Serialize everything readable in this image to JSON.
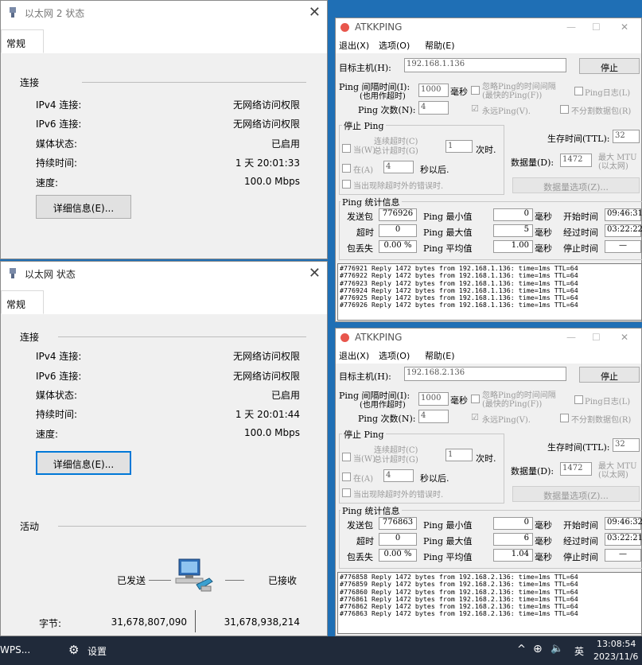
{
  "win1": {
    "title": "以太网 2 状态",
    "tab": "常规",
    "section_connection": "连接",
    "rows": [
      {
        "label": "IPv4 连接:",
        "value": "无网络访问权限"
      },
      {
        "label": "IPv6 连接:",
        "value": "无网络访问权限"
      },
      {
        "label": "媒体状态:",
        "value": "已启用"
      },
      {
        "label": "持续时间:",
        "value": "1 天 20:01:33"
      },
      {
        "label": "速度:",
        "value": "100.0 Mbps"
      }
    ],
    "details_button": "详细信息(E)..."
  },
  "win2": {
    "title": "以太网 状态",
    "tab": "常规",
    "section_connection": "连接",
    "rows": [
      {
        "label": "IPv4 连接:",
        "value": "无网络访问权限"
      },
      {
        "label": "IPv6 连接:",
        "value": "无网络访问权限"
      },
      {
        "label": "媒体状态:",
        "value": "已启用"
      },
      {
        "label": "持续时间:",
        "value": "1 天 20:01:44"
      },
      {
        "label": "速度:",
        "value": "100.0 Mbps"
      }
    ],
    "details_button": "详细信息(E)...",
    "section_activity": "活动",
    "sent_label": "已发送",
    "received_label": "已接收",
    "bytes_label": "字节:",
    "bytes_sent": "31,678,807,090",
    "bytes_received": "31,678,938,214"
  },
  "atk_common": {
    "title": "ATKKPING",
    "menu": [
      "退出(X)",
      "选项(O)",
      "帮助(E)"
    ],
    "target_label": "目标主机(H):",
    "stop_button": "停止",
    "ping_interval_label": "Ping 间隔时间(I):",
    "ping_interval_sub": "(也用作超时)",
    "ms_label": "毫秒",
    "ignore_interval_1": "忽略Ping的时间间隔",
    "ignore_interval_2": "(最快的Ping(F))",
    "ping_log_label": "Ping日志(L)",
    "ping_count_label": "Ping 次数(N):",
    "ping_count_value": "4",
    "forever_label": "永远Ping(V).",
    "no_fragment_label": "不分割数据包(R)",
    "stop_ping_group": "停止 Ping",
    "when_label": "当(W)",
    "consec_timeout": "连续超时(C)",
    "total_timeout": "总计超时(G)",
    "timeout_value": "1",
    "times_label": "次时.",
    "at_label": "在(A)",
    "at_value": "4",
    "seconds_after": "秒以后.",
    "error_stop": "当出现除超时外的错误时.",
    "ttl_label": "生存时间(TTL):",
    "ttl_value": "32",
    "data_size_label": "数据量(D):",
    "data_size_value": "1472",
    "max_mtu_1": "最大 MTU",
    "max_mtu_2": "(以太网)",
    "data_options": "数据量选项(Z)...",
    "stats_group": "Ping 统计信息",
    "sent_label": "发送包",
    "timeout_label": "超时",
    "loss_label": "包丢失",
    "min_label": "Ping 最小值",
    "max_label": "Ping 最大值",
    "avg_label": "Ping 平均值",
    "ms_unit": "毫秒",
    "start_label": "开始时间",
    "elapsed_label": "经过时间",
    "stop_time_label": "停止时间",
    "stop_time_value": "—"
  },
  "atk1": {
    "target": "192.168.1.136",
    "interval": "1000",
    "sent": "776926",
    "timeouts": "0",
    "loss": "0.00 %",
    "min": "0",
    "max": "5",
    "avg": "1.00",
    "start": "09:46:31",
    "elapsed": "03:22:22",
    "log": [
      "#776921 Reply 1472 bytes from 192.168.1.136: time=1ms TTL=64",
      "#776922 Reply 1472 bytes from 192.168.1.136: time=1ms TTL=64",
      "#776923 Reply 1472 bytes from 192.168.1.136: time=1ms TTL=64",
      "#776924 Reply 1472 bytes from 192.168.1.136: time=1ms TTL=64",
      "#776925 Reply 1472 bytes from 192.168.1.136: time=1ms TTL=64",
      "#776926 Reply 1472 bytes from 192.168.1.136: time=1ms TTL=64"
    ]
  },
  "atk2": {
    "target": "192.168.2.136",
    "interval": "1000",
    "sent": "776863",
    "timeouts": "0",
    "loss": "0.00 %",
    "min": "0",
    "max": "6",
    "avg": "1.04",
    "start": "09:46:32",
    "elapsed": "03:22:21",
    "log": [
      "#776858 Reply 1472 bytes from 192.168.2.136: time=1ms TTL=64",
      "#776859 Reply 1472 bytes from 192.168.2.136: time=1ms TTL=64",
      "#776860 Reply 1472 bytes from 192.168.2.136: time=1ms TTL=64",
      "#776861 Reply 1472 bytes from 192.168.2.136: time=1ms TTL=64",
      "#776862 Reply 1472 bytes from 192.168.2.136: time=1ms TTL=64",
      "#776863 Reply 1472 bytes from 192.168.2.136: time=1ms TTL=64"
    ]
  },
  "taskbar": {
    "wps_label": "WPS...",
    "settings_label": "设置",
    "ime_label": "英",
    "time": "13:08:54",
    "date": "2023/11/6"
  }
}
